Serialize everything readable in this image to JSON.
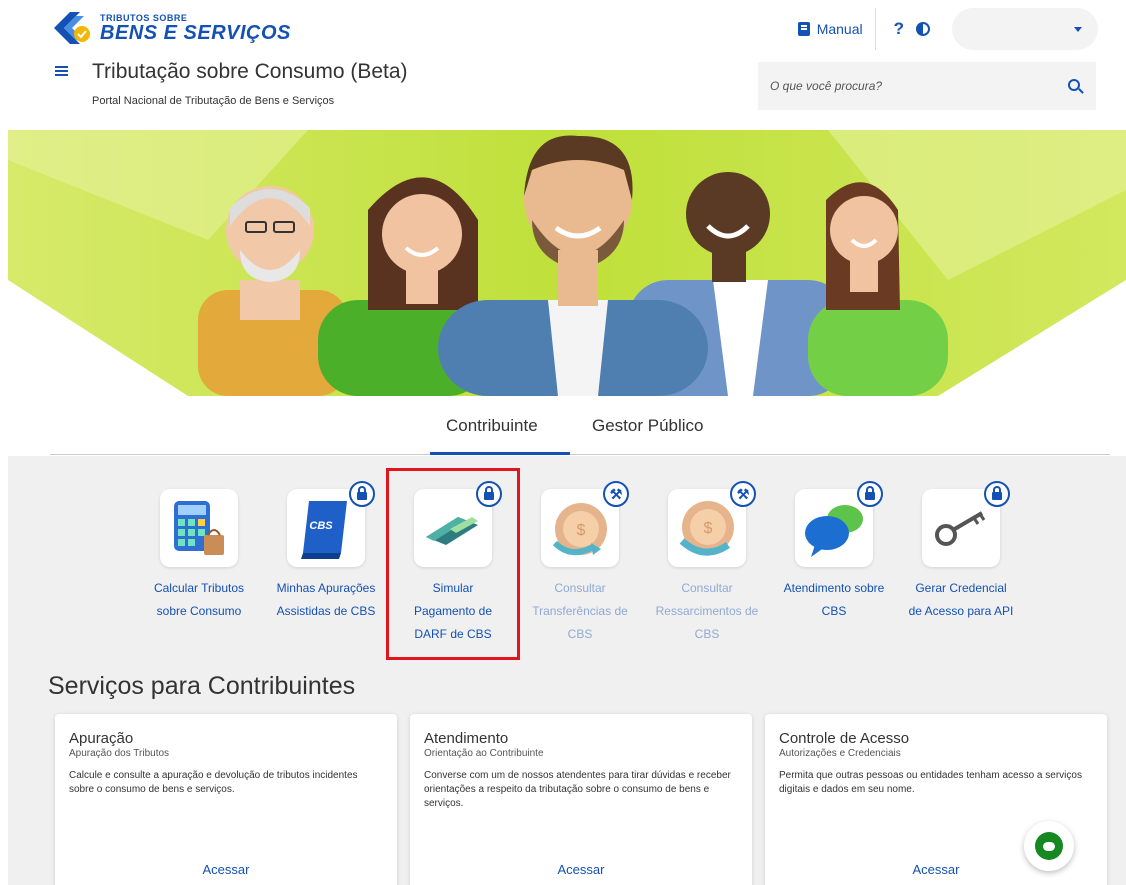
{
  "header": {
    "logo_small": "TRIBUTOS SOBRE",
    "logo_big": "BENS E SERVIÇOS",
    "manual_label": "Manual",
    "help_label": "?",
    "site_title": "Tributação sobre Consumo (Beta)",
    "site_subtitle": "Portal Nacional de Tributação de Bens e Serviços",
    "search_placeholder": "O que você procura?",
    "icons": [
      "book-icon",
      "help-icon",
      "contrast-icon",
      "chevron-down-icon",
      "menu-icon",
      "search-icon"
    ]
  },
  "tabs": [
    {
      "label": "Contribuinte",
      "active": true
    },
    {
      "label": "Gestor Público",
      "active": false
    }
  ],
  "services": [
    {
      "lines": [
        "Calcular Tributos",
        "sobre Consumo"
      ],
      "badge": "none",
      "enabled": true,
      "icon": "calculator-icon"
    },
    {
      "lines": [
        "Minhas Apurações",
        "Assistidas de CBS"
      ],
      "badge": "lock",
      "enabled": true,
      "icon": "cbs-book-icon"
    },
    {
      "lines": [
        "Simular",
        "Pagamento de",
        "DARF de CBS"
      ],
      "badge": "lock",
      "enabled": true,
      "icon": "money-bill-icon"
    },
    {
      "lines": [
        "Consultar",
        "Transferências de",
        "CBS"
      ],
      "badge": "wrench",
      "enabled": false,
      "icon": "coin-transfer-icon"
    },
    {
      "lines": [
        "Consultar",
        "Ressarcimentos de",
        "CBS"
      ],
      "badge": "wrench",
      "enabled": false,
      "icon": "coin-hand-icon"
    },
    {
      "lines": [
        "Atendimento sobre",
        "CBS"
      ],
      "badge": "lock",
      "enabled": true,
      "icon": "chat-bubbles-icon"
    },
    {
      "lines": [
        "Gerar Credencial",
        "de Acesso para API"
      ],
      "badge": "lock",
      "enabled": true,
      "icon": "key-icon"
    }
  ],
  "section_title": "Serviços para Contribuintes",
  "cards": [
    {
      "title": "Apuração",
      "subtitle": "Apuração dos Tributos",
      "description": "Calcule e consulte a apuração e devolução de tributos incidentes sobre o consumo de bens e serviços.",
      "button": "Acessar"
    },
    {
      "title": "Atendimento",
      "subtitle": "Orientação ao Contribuinte",
      "description": "Converse com um de nossos atendentes para tirar dúvidas e receber orientações a respeito da tributação sobre o consumo de bens e serviços.",
      "button": "Acessar"
    },
    {
      "title": "Controle de Acesso",
      "subtitle": "Autorizações e Credenciais",
      "description": "Permita que outras pessoas ou entidades tenham acesso a serviços digitais e dados em seu nome.",
      "button": "Acessar"
    }
  ],
  "colors": {
    "primary": "#1351b4",
    "highlight": "#e0161e",
    "banner_green": "#c8e24a",
    "chat_green": "#168821"
  }
}
